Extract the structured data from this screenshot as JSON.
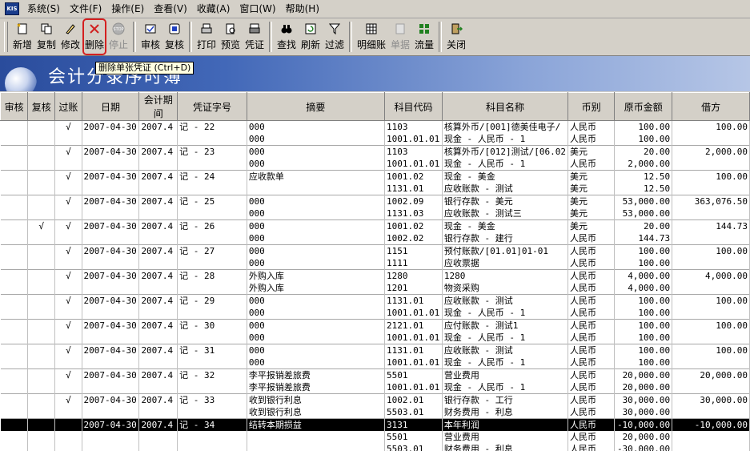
{
  "app": {
    "icon_text": "KIS"
  },
  "menu": [
    "系统(S)",
    "文件(F)",
    "操作(E)",
    "查看(V)",
    "收藏(A)",
    "窗口(W)",
    "帮助(H)"
  ],
  "toolbar": {
    "new": "新增",
    "copy": "复制",
    "modify": "修改",
    "delete": "删除",
    "stop": "停止",
    "audit": "审核",
    "recheck": "复核",
    "print": "打印",
    "preview": "预览",
    "voucher": "凭证",
    "find": "查找",
    "refresh": "刷新",
    "filter": "过滤",
    "detail": "明细账",
    "single": "单据",
    "flow": "流量",
    "close": "关闭"
  },
  "tooltip": "删除单张凭证 (Ctrl+D)",
  "banner": {
    "title": "会计分录序时簿"
  },
  "columns": [
    "审核",
    "复核",
    "过账",
    "日期",
    "会计期间",
    "凭证字号",
    "摘要",
    "科目代码",
    "科目名称",
    "币别",
    "原币金额",
    "借方"
  ],
  "rows": [
    [
      "",
      "",
      "√",
      "2007-04-30",
      "2007.4",
      "记 - 22",
      "000",
      "1103",
      "核算外币/[001]德美佳电子/",
      "人民币",
      "100.00",
      "100.00",
      "top"
    ],
    [
      "",
      "",
      "",
      "",
      "",
      "",
      "000",
      "1001.01.01",
      "现金 - 人民币 - 1",
      "人民币",
      "100.00",
      "",
      ""
    ],
    [
      "",
      "",
      "√",
      "2007-04-30",
      "2007.4",
      "记 - 23",
      "000",
      "1103",
      "核算外币/[012]测试/[06.02",
      "美元",
      "20.00",
      "2,000.00",
      "top"
    ],
    [
      "",
      "",
      "",
      "",
      "",
      "",
      "000",
      "1001.01.01",
      "现金 - 人民币 - 1",
      "人民币",
      "2,000.00",
      "",
      ""
    ],
    [
      "",
      "",
      "√",
      "2007-04-30",
      "2007.4",
      "记 - 24",
      "应收款单",
      "1001.02",
      "现金 - 美金",
      "美元",
      "12.50",
      "100.00",
      "top"
    ],
    [
      "",
      "",
      "",
      "",
      "",
      "",
      "",
      "1131.01",
      "应收账款 - 测试",
      "美元",
      "12.50",
      "",
      ""
    ],
    [
      "",
      "",
      "√",
      "2007-04-30",
      "2007.4",
      "记 - 25",
      "000",
      "1002.09",
      "银行存款 - 美元",
      "美元",
      "53,000.00",
      "363,076.50",
      "top"
    ],
    [
      "",
      "",
      "",
      "",
      "",
      "",
      "000",
      "1131.03",
      "应收账款 - 测试三",
      "美元",
      "53,000.00",
      "",
      ""
    ],
    [
      "",
      "√",
      "√",
      "2007-04-30",
      "2007.4",
      "记 - 26",
      "000",
      "1001.02",
      "现金 - 美金",
      "美元",
      "20.00",
      "144.73",
      "top"
    ],
    [
      "",
      "",
      "",
      "",
      "",
      "",
      "000",
      "1002.02",
      "银行存款 - 建行",
      "人民币",
      "144.73",
      "",
      ""
    ],
    [
      "",
      "",
      "√",
      "2007-04-30",
      "2007.4",
      "记 - 27",
      "000",
      "1151",
      "预付账款/[01.01]01-01",
      "人民币",
      "100.00",
      "100.00",
      "top"
    ],
    [
      "",
      "",
      "",
      "",
      "",
      "",
      "000",
      "1111",
      "应收票据",
      "人民币",
      "100.00",
      "",
      ""
    ],
    [
      "",
      "",
      "√",
      "2007-04-30",
      "2007.4",
      "记 - 28",
      "外购入库",
      "1280",
      "1280",
      "人民币",
      "4,000.00",
      "4,000.00",
      "top"
    ],
    [
      "",
      "",
      "",
      "",
      "",
      "",
      "外购入库",
      "1201",
      "物资采购",
      "人民币",
      "4,000.00",
      "",
      ""
    ],
    [
      "",
      "",
      "√",
      "2007-04-30",
      "2007.4",
      "记 - 29",
      "000",
      "1131.01",
      "应收账款 - 测试",
      "人民币",
      "100.00",
      "100.00",
      "top"
    ],
    [
      "",
      "",
      "",
      "",
      "",
      "",
      "000",
      "1001.01.01",
      "现金 - 人民币 - 1",
      "人民币",
      "100.00",
      "",
      ""
    ],
    [
      "",
      "",
      "√",
      "2007-04-30",
      "2007.4",
      "记 - 30",
      "000",
      "2121.01",
      "应付账款 - 测试1",
      "人民币",
      "100.00",
      "100.00",
      "top"
    ],
    [
      "",
      "",
      "",
      "",
      "",
      "",
      "000",
      "1001.01.01",
      "现金 - 人民币 - 1",
      "人民币",
      "100.00",
      "",
      ""
    ],
    [
      "",
      "",
      "√",
      "2007-04-30",
      "2007.4",
      "记 - 31",
      "000",
      "1131.01",
      "应收账款 - 测试",
      "人民币",
      "100.00",
      "100.00",
      "top"
    ],
    [
      "",
      "",
      "",
      "",
      "",
      "",
      "000",
      "1001.01.01",
      "现金 - 人民币 - 1",
      "人民币",
      "100.00",
      "",
      ""
    ],
    [
      "",
      "",
      "√",
      "2007-04-30",
      "2007.4",
      "记 - 32",
      "李平报销差旅费",
      "5501",
      "营业费用",
      "人民币",
      "20,000.00",
      "20,000.00",
      "top"
    ],
    [
      "",
      "",
      "",
      "",
      "",
      "",
      "李平报销差旅费",
      "1001.01.01",
      "现金 - 人民币 - 1",
      "人民币",
      "20,000.00",
      "",
      ""
    ],
    [
      "",
      "",
      "√",
      "2007-04-30",
      "2007.4",
      "记 - 33",
      "收到银行利息",
      "1002.01",
      "银行存款 - 工行",
      "人民币",
      "30,000.00",
      "30,000.00",
      "top"
    ],
    [
      "",
      "",
      "",
      "",
      "",
      "",
      "收到银行利息",
      "5503.01",
      "财务费用 - 利息",
      "人民币",
      "30,000.00",
      "",
      ""
    ],
    [
      "",
      "",
      "",
      "2007-04-30",
      "2007.4",
      "记 - 34",
      "结转本期损益",
      "3131",
      "本年利润",
      "人民币",
      "-10,000.00",
      "-10,000.00",
      "sel"
    ],
    [
      "",
      "",
      "",
      "",
      "",
      "",
      "",
      "5501",
      "营业费用",
      "人民币",
      "20,000.00",
      "",
      ""
    ],
    [
      "",
      "",
      "",
      "",
      "",
      "",
      "",
      "5503.01",
      "财务费用 - 利息",
      "人民币",
      "-30,000.00",
      "",
      ""
    ]
  ]
}
